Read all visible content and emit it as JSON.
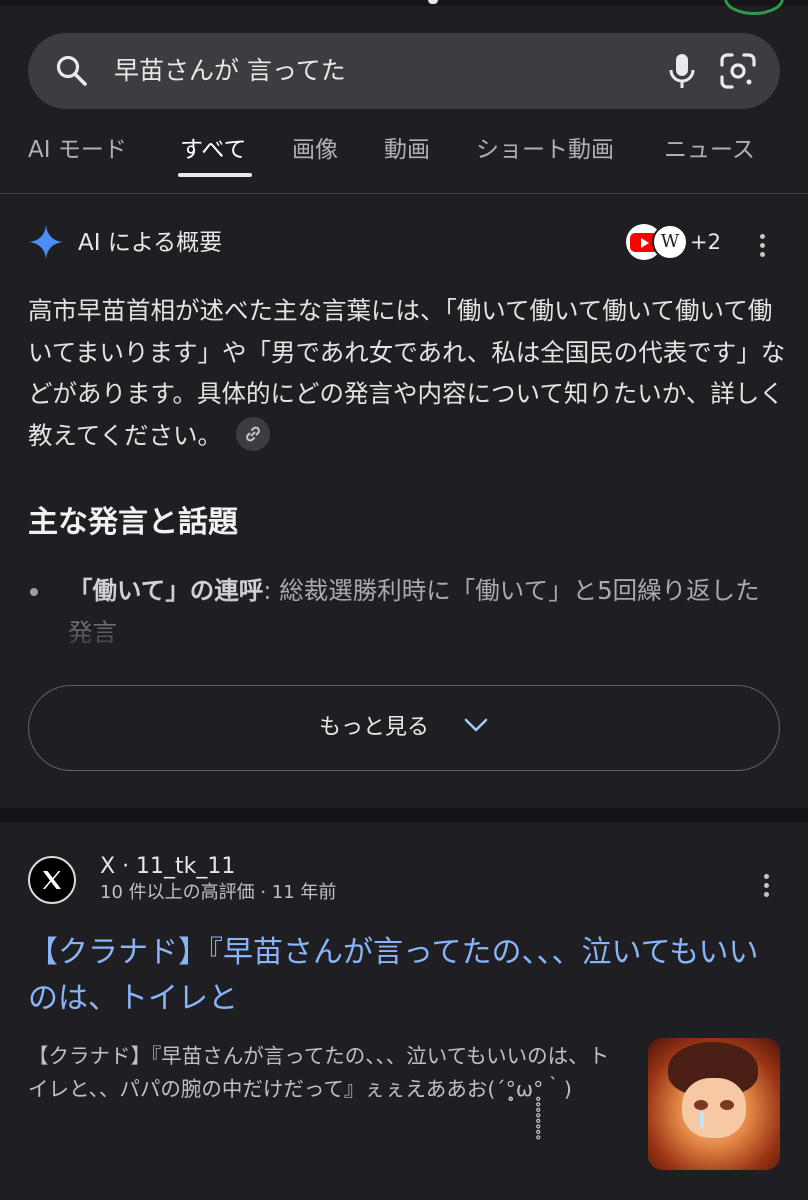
{
  "search": {
    "query": "早苗さんが 言ってた"
  },
  "tabs": [
    {
      "label": "AI モード"
    },
    {
      "label": "すべて"
    },
    {
      "label": "画像"
    },
    {
      "label": "動画"
    },
    {
      "label": "ショート動画"
    },
    {
      "label": "ニュース"
    }
  ],
  "ai_overview": {
    "title": "AI による概要",
    "sources_more": "+2",
    "source_wiki_glyph": "W",
    "summary": "高市早苗首相が述べた主な言葉には、「働いて働いて働いて働いて働いてまいります」や「男であれ女であれ、私は全国民の代表です」などがあります。具体的にどの発言や内容について知りたいか、詳しく教えてください。",
    "section_title": "主な発言と話題",
    "bullet_strong": "「働いて」の連呼",
    "bullet_text": ": 総裁選勝利時に「働いて」と5回繰り返した発言",
    "more_button": "もっと見る"
  },
  "result": {
    "site": "X · 11_tk_11",
    "meta": "10 件以上の高評価 · 11 年前",
    "title": "【クラナド】『早苗さんが言ってたの、、、泣いてもいいのは、トイレと",
    "snippet": "【クラナド】『早苗さんが言ってたの、、、泣いてもいいのは、トイレと、、パパの腕の中だけだって』ぇぇえああお(´°̥̥̥̥̥̥̥̥ω°̥̥̥̥̥̥̥̥｀)"
  },
  "colors": {
    "background": "#1f1f23",
    "link": "#8ab4f8",
    "accent_spark": "#4c8df6"
  }
}
